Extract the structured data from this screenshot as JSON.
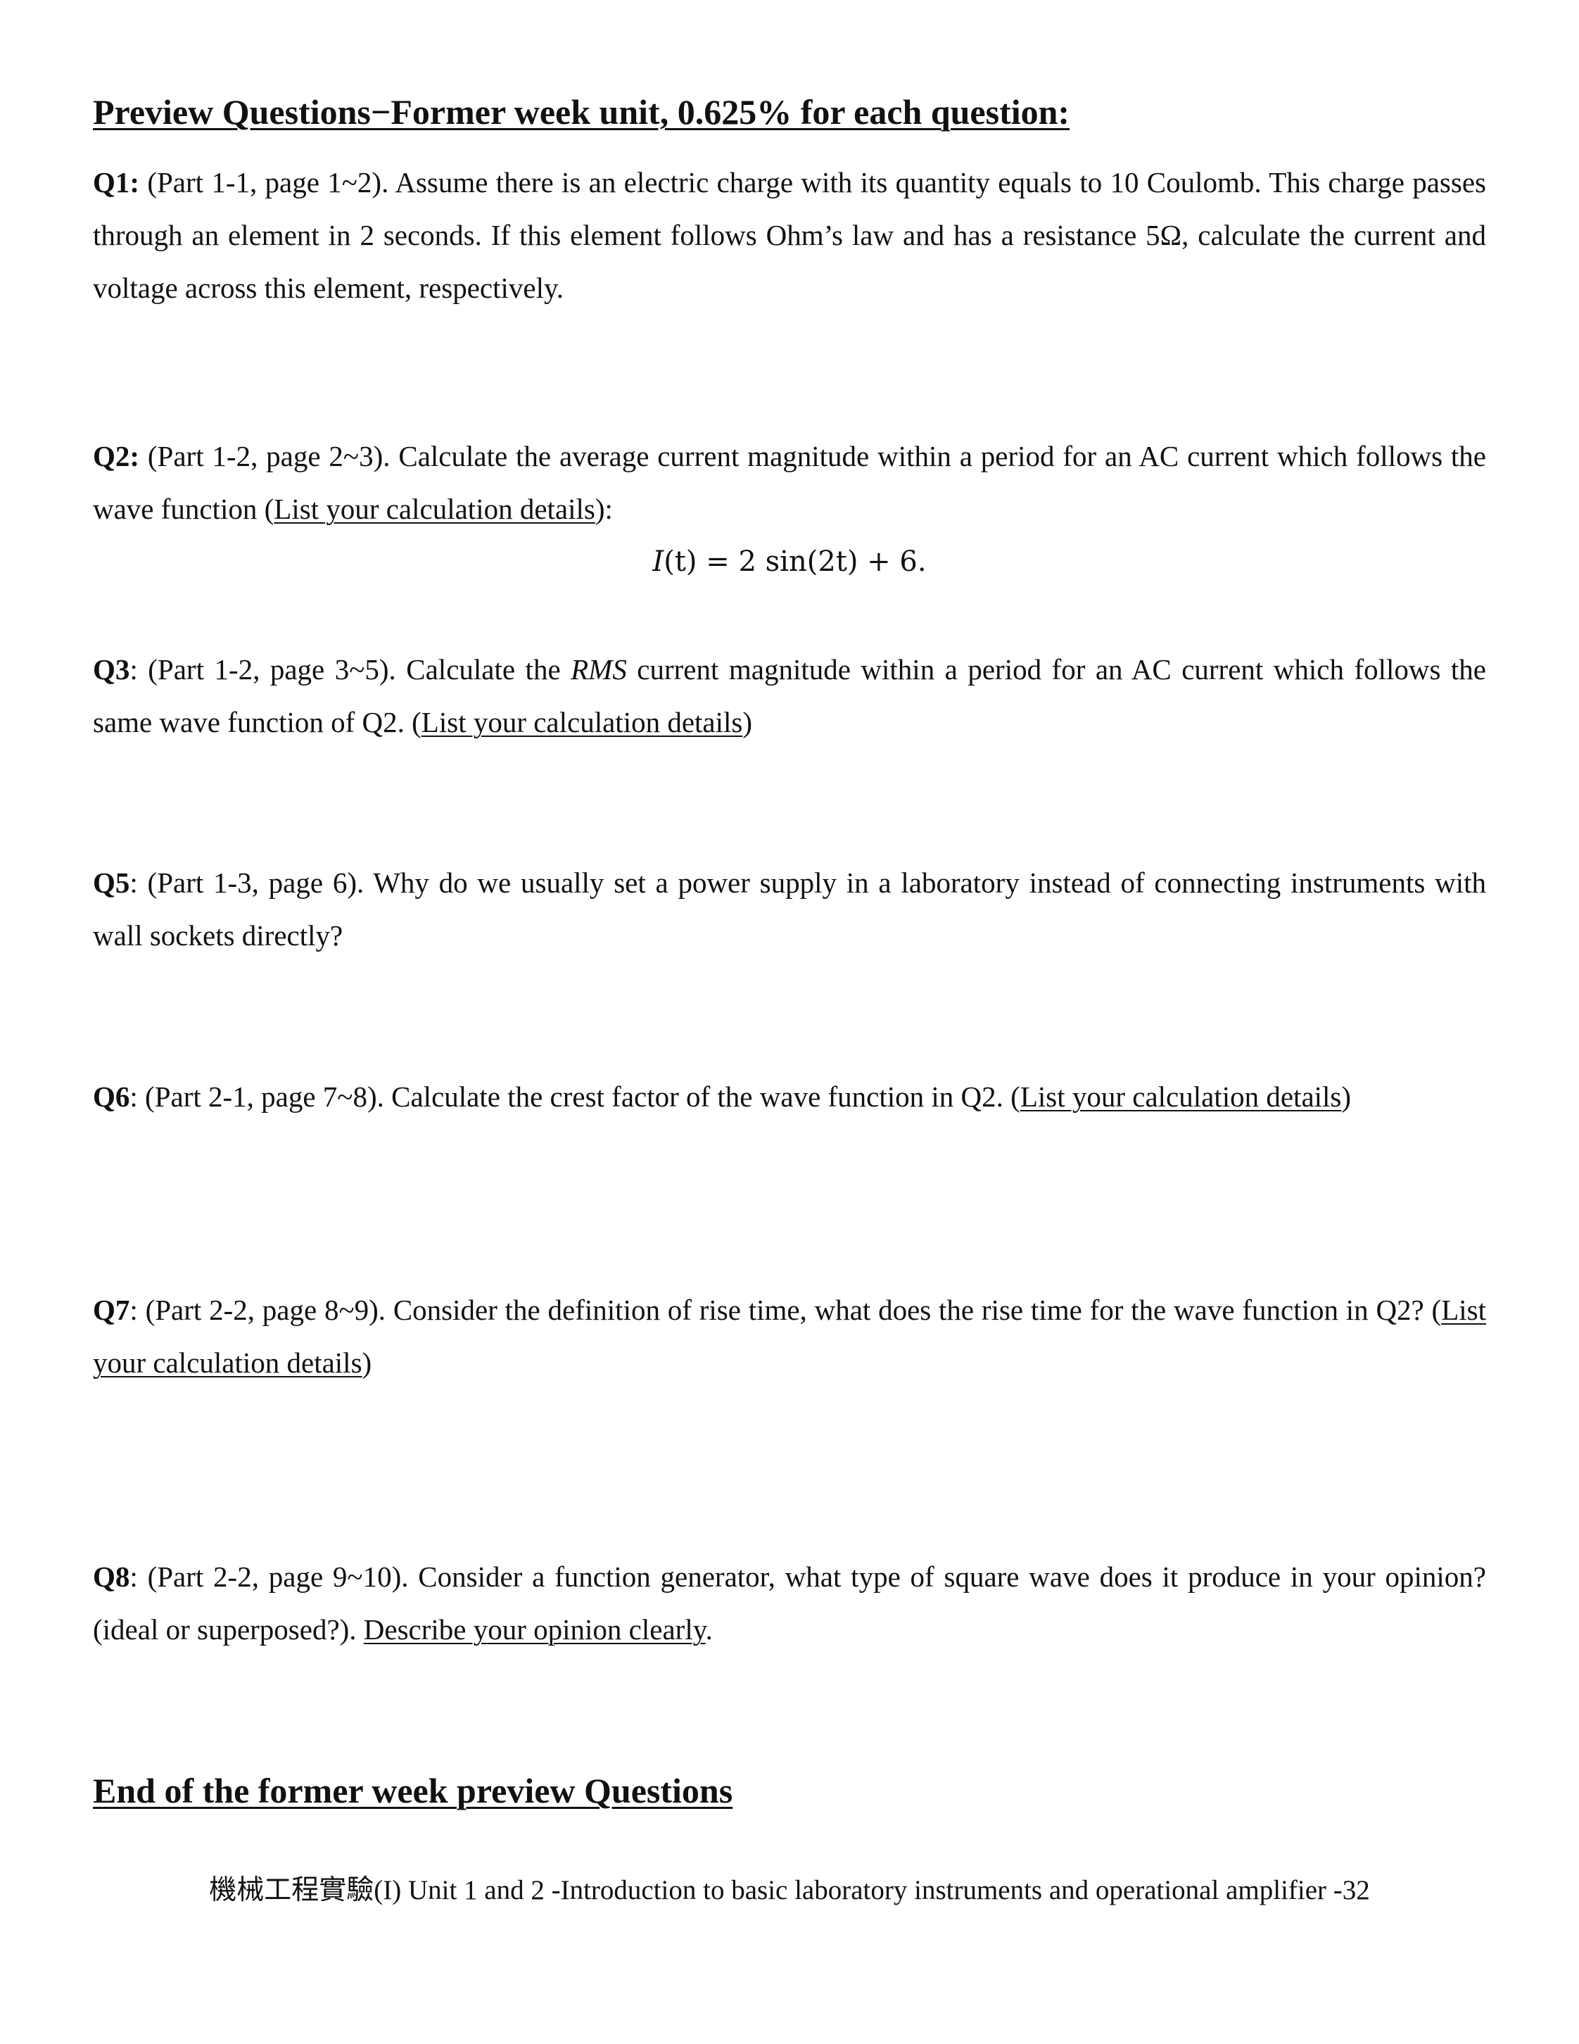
{
  "heading_top": "Preview Questions−Former week unit, 0.625% for each question:",
  "questions": {
    "q1": {
      "label": "Q1:",
      "text": " (Part 1-1, page 1~2). Assume there is an electric charge with its quantity equals to 10 Coulomb. This charge passes through an element in 2 seconds. If this element follows Ohm’s law and has a resistance 5Ω, calculate the current and voltage across this element, respectively."
    },
    "q2": {
      "label": "Q2:",
      "text_before": " (Part 1-2, page 2~3). Calculate the average current magnitude within a period for an AC current which follows the wave function (",
      "link": "List your calculation details",
      "text_after": "):"
    },
    "q2_equation": {
      "lhs_var": "I",
      "lhs_rest": "(t) = 2 sin(2t) + 6."
    },
    "q3": {
      "label": "Q3",
      "text_before": ": (Part 1-2, page 3~5). Calculate the ",
      "emph": "RMS",
      "text_middle": " current magnitude within a period for an AC current which follows the same wave function of Q2. (",
      "link": "List your calculation details",
      "text_after": ")"
    },
    "q5": {
      "label": "Q5",
      "text": ": (Part 1-3, page 6). Why do we usually set a power supply in a laboratory instead of connecting instruments with wall sockets directly?"
    },
    "q6": {
      "label": "Q6",
      "text_before": ": (Part 2-1, page 7~8). Calculate the crest factor of the wave function in Q2. (",
      "link": "List your calculation details",
      "text_after": ")"
    },
    "q7": {
      "label": "Q7",
      "text_before": ": (Part 2-2, page 8~9). Consider the definition of rise time, what does the rise time for the wave function in Q2? (",
      "link": "List your calculation details",
      "text_after": ")"
    },
    "q8": {
      "label": "Q8",
      "text_before": ": (Part 2-2, page 9~10). Consider a function generator, what type of square wave does it produce in your opinion? (ideal or superposed?). ",
      "link": "Describe your opinion clearly",
      "text_after": "."
    }
  },
  "heading_end": "End of the former week preview Questions",
  "footer": "機械工程實驗(I) Unit 1 and 2 -Introduction to basic laboratory instruments and operational amplifier -32"
}
